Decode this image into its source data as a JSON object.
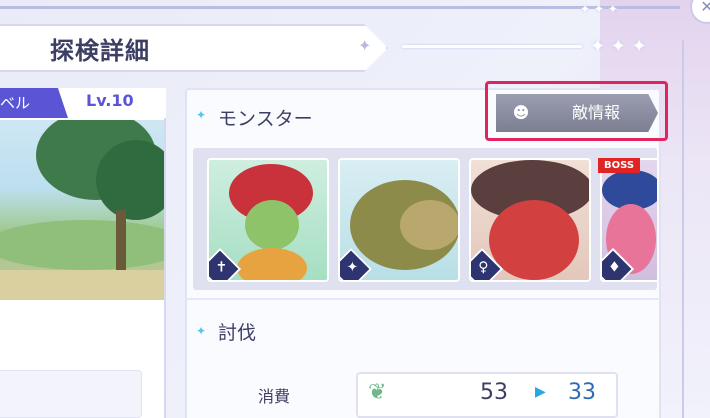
{
  "header": {
    "title": "探検詳細"
  },
  "left_panel": {
    "level_label": "ベル",
    "level_value": "Lv.10"
  },
  "monsters_section": {
    "title": "モンスター",
    "enemy_info_button": "敵情報",
    "monsters": [
      {
        "name": "flower-monster",
        "role_icon": "✝"
      },
      {
        "name": "wolf-monster",
        "role_icon": "✦"
      },
      {
        "name": "red-ogre-monster",
        "role_icon": "♀"
      },
      {
        "name": "boss-monster",
        "role_icon": "♦",
        "badge": "BOSS"
      }
    ]
  },
  "subjugation_section": {
    "title": "討伐",
    "cost_label": "消費",
    "cost_from": "53",
    "cost_to": "33"
  },
  "colors": {
    "accent_purple": "#5b55d6",
    "highlight": "#e0245e",
    "boss_red": "#e02424",
    "role_navy": "#2e3470"
  }
}
